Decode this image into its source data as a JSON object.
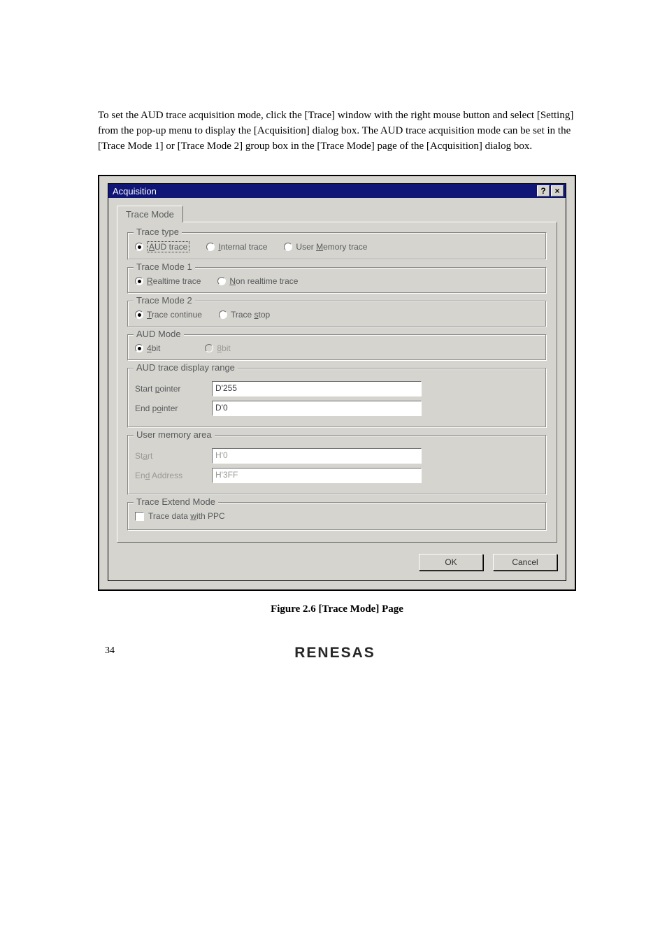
{
  "intro": "To set the AUD trace acquisition mode, click the [Trace] window with the right mouse button and select [Setting] from the pop-up menu to display the [Acquisition] dialog box.  The AUD trace acquisition mode can be set in the [Trace Mode 1] or [Trace Mode 2] group box in the [Trace Mode] page of the [Acquisition] dialog box.",
  "dialog": {
    "title": "Acquisition",
    "help": "?",
    "close": "×",
    "tab": "Trace Mode",
    "groups": {
      "trace_type": {
        "label": "Trace type",
        "aud_pre": "A",
        "aud_post": "UD trace",
        "internal_pre": "I",
        "internal_post": "nternal trace",
        "user_pre": "User ",
        "user_u": "M",
        "user_post": "emory trace"
      },
      "trace_mode1": {
        "label": "Trace Mode 1",
        "real_pre": "R",
        "real_post": "ealtime trace",
        "non_pre": "N",
        "non_post": "on realtime trace"
      },
      "trace_mode2": {
        "label": "Trace Mode 2",
        "cont_pre": "T",
        "cont_post": "race continue",
        "stop_pre": "Trace ",
        "stop_u": "s",
        "stop_post": "top"
      },
      "aud_mode": {
        "label": "AUD Mode",
        "b4_pre": "4",
        "b4_post": "bit",
        "b8_pre": "8",
        "b8_post": "bit"
      },
      "display_range": {
        "label": "AUD trace display range",
        "start_label_pre": "Start ",
        "start_label_u": "p",
        "start_label_post": "ointer",
        "start_value": "D'255",
        "end_label_pre": "End p",
        "end_label_u": "o",
        "end_label_post": "inter",
        "end_value": "D'0"
      },
      "user_memory": {
        "label": "User memory area",
        "start_label_pre": "St",
        "start_label_u": "a",
        "start_label_post": "rt",
        "start_value": "H'0",
        "end_label_pre": "En",
        "end_label_u": "d",
        "end_label_post": " Address",
        "end_value": "H'3FF"
      },
      "extend": {
        "label": "Trace Extend Mode",
        "check_pre": "Trace data ",
        "check_u": "w",
        "check_post": "ith PPC"
      }
    },
    "ok": "OK",
    "cancel": "Cancel"
  },
  "caption": "Figure 2.6   [Trace Mode] Page",
  "pagenum": "34",
  "logo": "RENESAS"
}
